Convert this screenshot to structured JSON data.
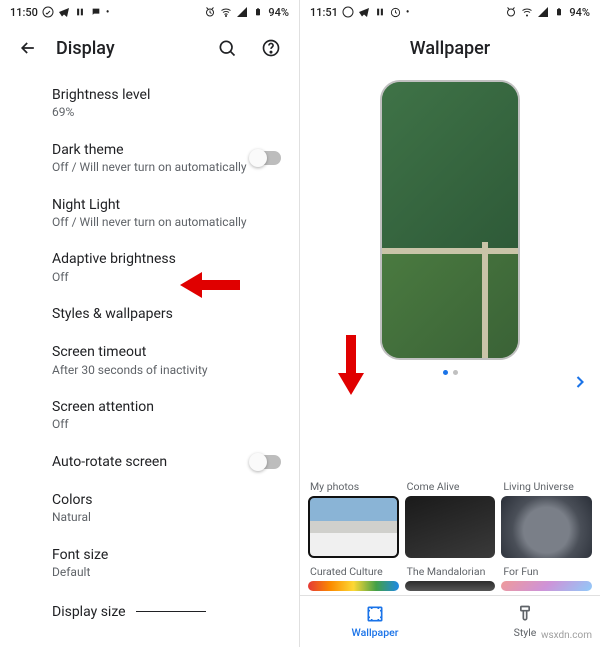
{
  "left": {
    "status": {
      "time": "11:50",
      "battery": "94%"
    },
    "title": "Display",
    "items": [
      {
        "title": "Brightness level",
        "sub": "69%",
        "toggle": false
      },
      {
        "title": "Dark theme",
        "sub": "Off / Will never turn on automatically",
        "toggle": true
      },
      {
        "title": "Night Light",
        "sub": "Off / Will never turn on automatically",
        "toggle": false
      },
      {
        "title": "Adaptive brightness",
        "sub": "Off",
        "toggle": false
      },
      {
        "title": "Styles & wallpapers",
        "sub": "",
        "toggle": false
      },
      {
        "title": "Screen timeout",
        "sub": "After 30 seconds of inactivity",
        "toggle": false
      },
      {
        "title": "Screen attention",
        "sub": "Off",
        "toggle": false
      },
      {
        "title": "Auto-rotate screen",
        "sub": "",
        "toggle": true
      },
      {
        "title": "Colors",
        "sub": "Natural",
        "toggle": false
      },
      {
        "title": "Font size",
        "sub": "Default",
        "toggle": false
      },
      {
        "title": "Display size",
        "sub": "",
        "toggle": false
      }
    ]
  },
  "right": {
    "status": {
      "time": "11:51",
      "battery": "94%"
    },
    "title": "Wallpaper",
    "categories_row1": [
      {
        "label": "My photos",
        "cls": "thumb-my"
      },
      {
        "label": "Come Alive",
        "cls": "thumb-alive"
      },
      {
        "label": "Living Universe",
        "cls": "thumb-universe"
      }
    ],
    "categories_row2": [
      {
        "label": "Curated Culture",
        "cls": "thumb-culture"
      },
      {
        "label": "The Mandalorian",
        "cls": "thumb-mando"
      },
      {
        "label": "For Fun",
        "cls": "thumb-fun"
      }
    ],
    "nav": {
      "wallpaper": "Wallpaper",
      "style": "Style"
    }
  },
  "watermark": "wsxdn.com"
}
